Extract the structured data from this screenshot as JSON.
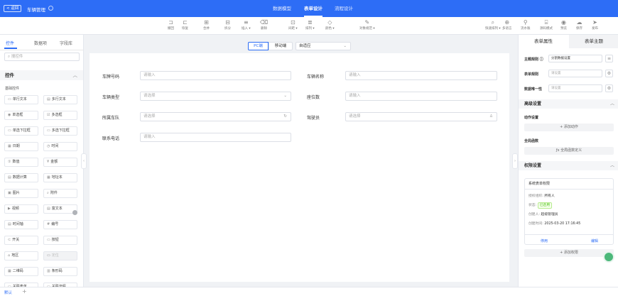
{
  "header": {
    "back_label": "< 返回",
    "app_title": "车辆管理",
    "tabs": [
      "数据模型",
      "表单设计",
      "流程设计"
    ]
  },
  "toolbar": {
    "left_tools": [
      {
        "label": "撤回",
        "icon": "undo-icon"
      },
      {
        "label": "恢复",
        "icon": "redo-icon"
      },
      {
        "label": "合并",
        "icon": "merge-icon"
      },
      {
        "label": "拆分",
        "icon": "split-icon"
      },
      {
        "label": "插入 ▾",
        "icon": "insert-icon"
      },
      {
        "label": "删除",
        "icon": "delete-icon"
      },
      {
        "label": "间距 ▾",
        "icon": "spacing-icon"
      },
      {
        "label": "排列 ▾",
        "icon": "align-icon"
      },
      {
        "label": "颜色 ▾",
        "icon": "color-icon"
      },
      {
        "label": "对象规范 ▾",
        "icon": "style-icon"
      }
    ],
    "right_tools": [
      {
        "label": "快速排列 ▾",
        "icon": "layout-icon"
      },
      {
        "label": "多语言",
        "icon": "globe-icon"
      },
      {
        "label": "流水账",
        "icon": "flow-icon"
      },
      {
        "label": "源码模式",
        "icon": "code-icon"
      },
      {
        "label": "预览",
        "icon": "eye-icon"
      },
      {
        "label": "保存",
        "icon": "cloud-icon"
      },
      {
        "label": "发布",
        "icon": "send-icon"
      }
    ]
  },
  "left_panel": {
    "tabs": [
      "控件",
      "数据项",
      "字段库"
    ],
    "search_placeholder": "搜控件",
    "group_title": "控件",
    "subgroup_title": "基础控件",
    "controls": [
      {
        "icon": "▭",
        "label": "单行文本"
      },
      {
        "icon": "▤",
        "label": "多行文本"
      },
      {
        "icon": "◉",
        "label": "单选框"
      },
      {
        "icon": "☑",
        "label": "多选框"
      },
      {
        "icon": "▭",
        "label": "单选下拉框"
      },
      {
        "icon": "▭",
        "label": "多选下拉框"
      },
      {
        "icon": "▦",
        "label": "日期"
      },
      {
        "icon": "◷",
        "label": "时间"
      },
      {
        "icon": "①",
        "label": "数值"
      },
      {
        "icon": "¥",
        "label": "金额"
      },
      {
        "icon": "▤",
        "label": "数据计算"
      },
      {
        "icon": "▦",
        "label": "地址本"
      },
      {
        "icon": "▣",
        "label": "图片"
      },
      {
        "icon": "⌕",
        "label": "附件"
      },
      {
        "icon": "▶",
        "label": "视频"
      },
      {
        "icon": "▤",
        "label": "富文本"
      },
      {
        "icon": "▤",
        "label": "时间轴"
      },
      {
        "icon": "#",
        "label": "编号"
      },
      {
        "icon": "⊂",
        "label": "开关"
      },
      {
        "icon": "▭",
        "label": "按钮"
      },
      {
        "icon": "⌂",
        "label": "地区"
      },
      {
        "icon": "▭",
        "label": "定位"
      },
      {
        "icon": "▦",
        "label": "二维码"
      },
      {
        "icon": "▥",
        "label": "条形码"
      },
      {
        "icon": "▭",
        "label": "关联表单"
      },
      {
        "icon": "▭",
        "label": "关联流程"
      }
    ]
  },
  "bottom": {
    "tab": "默认",
    "add": "+"
  },
  "center": {
    "device_tabs": [
      "PC端",
      "移动端"
    ],
    "adapt_select": "自适应",
    "fields": [
      {
        "label": "车牌号码",
        "placeholder": "请输入",
        "suffix": ""
      },
      {
        "label": "车辆名称",
        "placeholder": "请输入",
        "suffix": ""
      },
      {
        "label": "车辆类型",
        "placeholder": "请选择",
        "suffix": "⌄"
      },
      {
        "label": "座位数",
        "placeholder": "请输入",
        "suffix": ""
      },
      {
        "label": "所属车队",
        "placeholder": "请选择",
        "suffix": "↻"
      },
      {
        "label": "驾驶员",
        "placeholder": "请选择",
        "suffix": "♙"
      },
      {
        "label": "联系电话",
        "placeholder": "请输入",
        "suffix": ""
      }
    ]
  },
  "right_panel": {
    "tabs": [
      "表单属性",
      "表单主题"
    ],
    "props": [
      {
        "label": "主题规则 ⓘ",
        "value": "分割数据设置",
        "btn": "≡"
      },
      {
        "label": "表单规则",
        "value": "请设置",
        "btn": "⚙"
      },
      {
        "label": "数据唯一性",
        "value": "请设置",
        "btn": "⚙"
      }
    ],
    "advanced_title": "高级设置",
    "action_title": "动作设置",
    "add_action": "+ 添加动作",
    "global_func_title": "全局函数",
    "global_func_btn": "ƒx 全局函数定义",
    "permission_title": "权限设置",
    "perm_card": {
      "title": "系统表单权限",
      "scope_label": "授权组织:",
      "scope_value": "所有人",
      "status_label": "状态:",
      "status_value": "已启用",
      "creator_label": "创建人:",
      "creator_value": "超级管理员",
      "time_label": "创建时间:",
      "time_value": "2025-03-20 17:16:45",
      "link_detail": "停用",
      "link_edit": "编辑"
    },
    "add_permission": "+ 添加权限"
  }
}
